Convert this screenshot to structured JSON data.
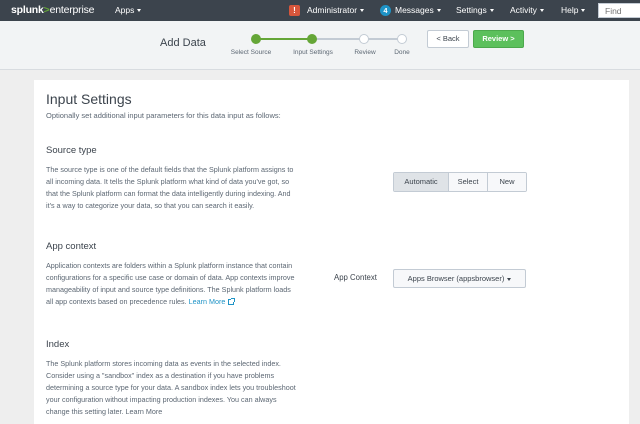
{
  "topbar": {
    "logo_main": "splunk",
    "logo_arrow": ">",
    "logo_product": "enterprise",
    "apps": "Apps",
    "administrator": "Administrator",
    "warning_glyph": "!",
    "messages_count": "4",
    "messages": "Messages",
    "settings": "Settings",
    "activity": "Activity",
    "help": "Help",
    "find_placeholder": "Find"
  },
  "wizard": {
    "title": "Add Data",
    "steps": [
      {
        "label": "Select Source",
        "status": "done"
      },
      {
        "label": "Input Settings",
        "status": "current"
      },
      {
        "label": "Review",
        "status": "todo"
      },
      {
        "label": "Done",
        "status": "todo"
      }
    ],
    "back_label": "< Back",
    "review_label": "Review >"
  },
  "main": {
    "title": "Input Settings",
    "intro": "Optionally set additional input parameters for this data input as follows:",
    "source_type": {
      "title": "Source type",
      "body": "The source type is one of the default fields that the Splunk platform assigns to all incoming data. It tells the Splunk platform what kind of data you've got, so that the Splunk platform can format the data intelligently during indexing. And it's a way to categorize your data, so that you can search it easily.",
      "options": [
        "Automatic",
        "Select",
        "New"
      ],
      "selected": "Automatic"
    },
    "app_context": {
      "title": "App context",
      "body": "Application contexts are folders within a Splunk platform instance that contain configurations for a specific use case or domain of data. App contexts improve manageability of input and source type definitions. The Splunk platform loads all app contexts based on precedence rules.",
      "learn_more": "Learn More",
      "field_label": "App Context",
      "value": "Apps Browser (appsbrowser)"
    },
    "index": {
      "title": "Index",
      "body": "The Splunk platform stores incoming data as events in the selected index. Consider using a \"sandbox\" index as a destination if you have problems determining a source type for your data. A sandbox index lets you troubleshoot your configuration without impacting production indexes. You can always change this setting later. Learn More"
    }
  },
  "colors": {
    "topbar_bg": "#3c444d",
    "accent_green": "#65a637",
    "review_button": "#5cc05c",
    "link_blue": "#1e93c6",
    "warning_red": "#d6563c"
  }
}
